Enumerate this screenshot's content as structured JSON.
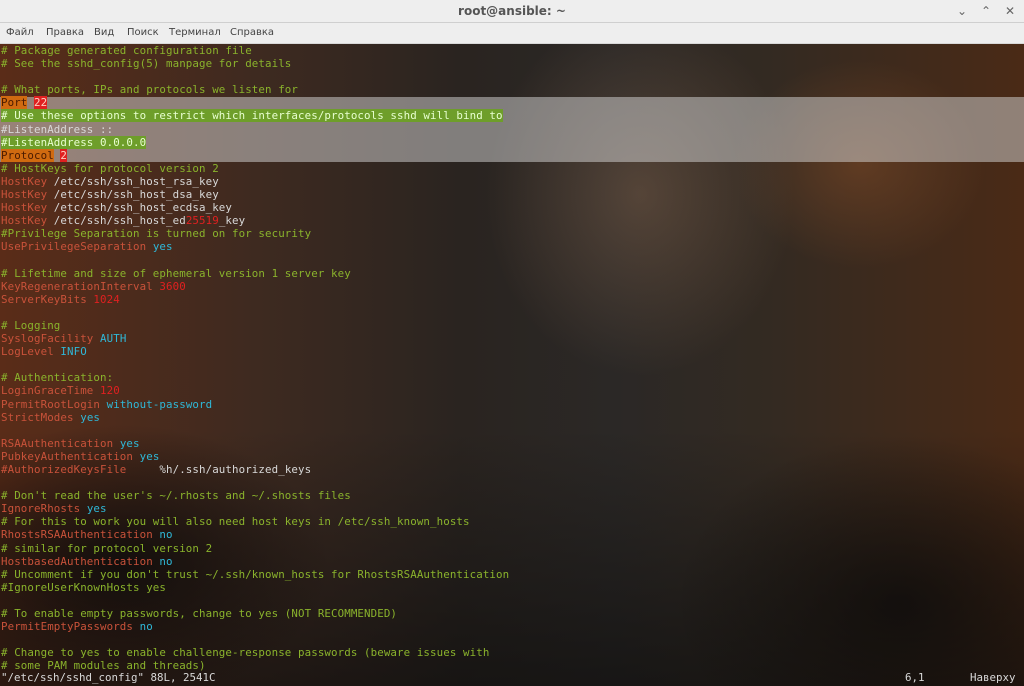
{
  "window": {
    "title": "root@ansible: ~",
    "controls": {
      "minimize": "⌄",
      "maximize": "⌃",
      "close": "✕"
    }
  },
  "menu": [
    {
      "label": "Файл",
      "icon": "menu"
    },
    {
      "label": "Правка",
      "icon": "menu"
    },
    {
      "label": "Вид",
      "icon": "menu"
    },
    {
      "label": "Поиск",
      "icon": "menu"
    },
    {
      "label": "Терминал",
      "icon": "menu"
    },
    {
      "label": "Справка",
      "icon": "menu"
    }
  ],
  "editor": {
    "selection_lines": [
      4,
      8
    ],
    "lines": [
      [
        {
          "t": "# Package generated configuration file",
          "s": "comment"
        }
      ],
      [
        {
          "t": "# See the sshd_config(5) manpage for details",
          "s": "comment"
        }
      ],
      [
        {
          "t": "",
          "s": "text"
        }
      ],
      [
        {
          "t": "# What ports, IPs and protocols we listen for",
          "s": "comment"
        }
      ],
      [
        {
          "t": "Port",
          "s": "hl-key"
        },
        {
          "t": " ",
          "s": "text"
        },
        {
          "t": "22",
          "s": "hl-num"
        }
      ],
      [
        {
          "t": "# Use these options to restrict which interfaces/protocols sshd will bind to",
          "s": "hl-bg"
        }
      ],
      [
        {
          "t": "#ListenAddress ::",
          "s": "text"
        }
      ],
      [
        {
          "t": "#ListenAddress 0.0.0.0",
          "s": "hl-bg"
        }
      ],
      [
        {
          "t": "Protocol",
          "s": "hl-key"
        },
        {
          "t": " ",
          "s": "text"
        },
        {
          "t": "2",
          "s": "hl-num"
        }
      ],
      [
        {
          "t": "# HostKeys for protocol version 2",
          "s": "comment"
        }
      ],
      [
        {
          "t": "HostKey",
          "s": "key"
        },
        {
          "t": " /etc/ssh/ssh_host_rsa_key",
          "s": "text"
        }
      ],
      [
        {
          "t": "HostKey",
          "s": "key"
        },
        {
          "t": " /etc/ssh/ssh_host_dsa_key",
          "s": "text"
        }
      ],
      [
        {
          "t": "HostKey",
          "s": "key"
        },
        {
          "t": " /etc/ssh/ssh_host_ecdsa_key",
          "s": "text"
        }
      ],
      [
        {
          "t": "HostKey",
          "s": "key"
        },
        {
          "t": " /etc/ssh/ssh_host_ed",
          "s": "text"
        },
        {
          "t": "25519",
          "s": "num"
        },
        {
          "t": "_key",
          "s": "text"
        }
      ],
      [
        {
          "t": "#Privilege Separation is turned on for security",
          "s": "comment"
        }
      ],
      [
        {
          "t": "UsePrivilegeSeparation",
          "s": "key"
        },
        {
          "t": " ",
          "s": "text"
        },
        {
          "t": "yes",
          "s": "val"
        }
      ],
      [
        {
          "t": "",
          "s": "text"
        }
      ],
      [
        {
          "t": "# Lifetime and size of ephemeral version 1 server key",
          "s": "comment"
        }
      ],
      [
        {
          "t": "KeyRegenerationInterval",
          "s": "key"
        },
        {
          "t": " ",
          "s": "text"
        },
        {
          "t": "3600",
          "s": "num"
        }
      ],
      [
        {
          "t": "ServerKeyBits",
          "s": "key"
        },
        {
          "t": " ",
          "s": "text"
        },
        {
          "t": "1024",
          "s": "num"
        }
      ],
      [
        {
          "t": "",
          "s": "text"
        }
      ],
      [
        {
          "t": "# Logging",
          "s": "comment"
        }
      ],
      [
        {
          "t": "SyslogFacility",
          "s": "key"
        },
        {
          "t": " ",
          "s": "text"
        },
        {
          "t": "AUTH",
          "s": "val"
        }
      ],
      [
        {
          "t": "LogLevel",
          "s": "key"
        },
        {
          "t": " ",
          "s": "text"
        },
        {
          "t": "INFO",
          "s": "val"
        }
      ],
      [
        {
          "t": "",
          "s": "text"
        }
      ],
      [
        {
          "t": "# Authentication:",
          "s": "comment"
        }
      ],
      [
        {
          "t": "LoginGraceTime",
          "s": "key"
        },
        {
          "t": " ",
          "s": "text"
        },
        {
          "t": "120",
          "s": "num"
        }
      ],
      [
        {
          "t": "PermitRootLogin",
          "s": "key"
        },
        {
          "t": " ",
          "s": "text"
        },
        {
          "t": "without-password",
          "s": "val"
        }
      ],
      [
        {
          "t": "StrictModes",
          "s": "key"
        },
        {
          "t": " ",
          "s": "text"
        },
        {
          "t": "yes",
          "s": "val"
        }
      ],
      [
        {
          "t": "",
          "s": "text"
        }
      ],
      [
        {
          "t": "RSAAuthentication",
          "s": "key"
        },
        {
          "t": " ",
          "s": "text"
        },
        {
          "t": "yes",
          "s": "val"
        }
      ],
      [
        {
          "t": "PubkeyAuthentication",
          "s": "key"
        },
        {
          "t": " ",
          "s": "text"
        },
        {
          "t": "yes",
          "s": "val"
        }
      ],
      [
        {
          "t": "#AuthorizedKeysFile",
          "s": "key"
        },
        {
          "t": "     %h/.ssh/authorized_keys",
          "s": "text"
        }
      ],
      [
        {
          "t": "",
          "s": "text"
        }
      ],
      [
        {
          "t": "# Don't read the user's ~/.rhosts and ~/.shosts files",
          "s": "comment"
        }
      ],
      [
        {
          "t": "IgnoreRhosts",
          "s": "key"
        },
        {
          "t": " ",
          "s": "text"
        },
        {
          "t": "yes",
          "s": "val"
        }
      ],
      [
        {
          "t": "# For this to work you will also need host keys in /etc/ssh_known_hosts",
          "s": "comment"
        }
      ],
      [
        {
          "t": "RhostsRSAAuthentication",
          "s": "key"
        },
        {
          "t": " ",
          "s": "text"
        },
        {
          "t": "no",
          "s": "val"
        }
      ],
      [
        {
          "t": "# similar for protocol version 2",
          "s": "comment"
        }
      ],
      [
        {
          "t": "HostbasedAuthentication",
          "s": "key"
        },
        {
          "t": " ",
          "s": "text"
        },
        {
          "t": "no",
          "s": "val"
        }
      ],
      [
        {
          "t": "# Uncomment if you don't trust ~/.ssh/known_hosts for RhostsRSAAuthentication",
          "s": "comment"
        }
      ],
      [
        {
          "t": "#IgnoreUserKnownHosts yes",
          "s": "comment"
        }
      ],
      [
        {
          "t": "",
          "s": "text"
        }
      ],
      [
        {
          "t": "# To enable empty passwords, change to yes (NOT RECOMMENDED)",
          "s": "comment"
        }
      ],
      [
        {
          "t": "PermitEmptyPasswords",
          "s": "key"
        },
        {
          "t": " ",
          "s": "text"
        },
        {
          "t": "no",
          "s": "val"
        }
      ],
      [
        {
          "t": "",
          "s": "text"
        }
      ],
      [
        {
          "t": "# Change to yes to enable challenge-response passwords (beware issues with",
          "s": "comment"
        }
      ],
      [
        {
          "t": "# some PAM modules and threads)",
          "s": "comment"
        }
      ]
    ]
  },
  "status": {
    "file": "\"/etc/ssh/sshd_config\" 88L, 2541C",
    "position": "6,1",
    "scroll": "Наверху"
  },
  "colors": {
    "comment": "#8ab32c",
    "keyword": "#c9523a",
    "value": "#2fb8d8",
    "number": "#e02020",
    "text": "#d8d8d8"
  }
}
